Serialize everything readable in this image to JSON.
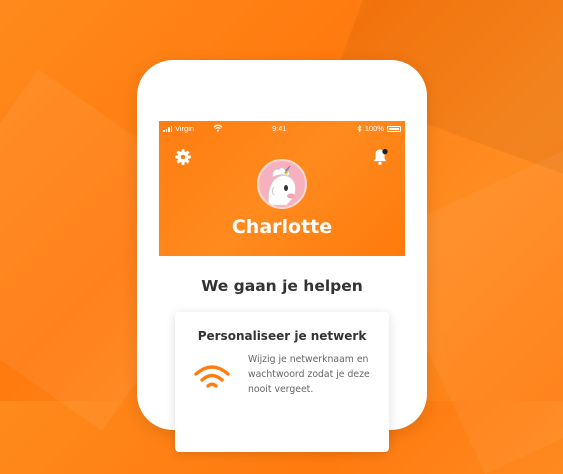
{
  "colors": {
    "brand_orange": "#ff7d10",
    "card_bg": "#ffffff",
    "heading_text": "#333333",
    "body_text": "#666666"
  },
  "status_bar": {
    "carrier": "Virgin",
    "time": "9:41",
    "battery": "100%"
  },
  "header": {
    "settings_icon": "gear-icon",
    "notifications_icon": "bell-icon",
    "avatar_icon": "unicorn-avatar",
    "user_name": "Charlotte"
  },
  "main": {
    "section_title": "We gaan je helpen",
    "card": {
      "title": "Personaliseer je netwerk",
      "icon": "wifi-icon",
      "text": "Wijzig je netwerknaam en wachtwoord zodat je deze nooit vergeet."
    }
  }
}
